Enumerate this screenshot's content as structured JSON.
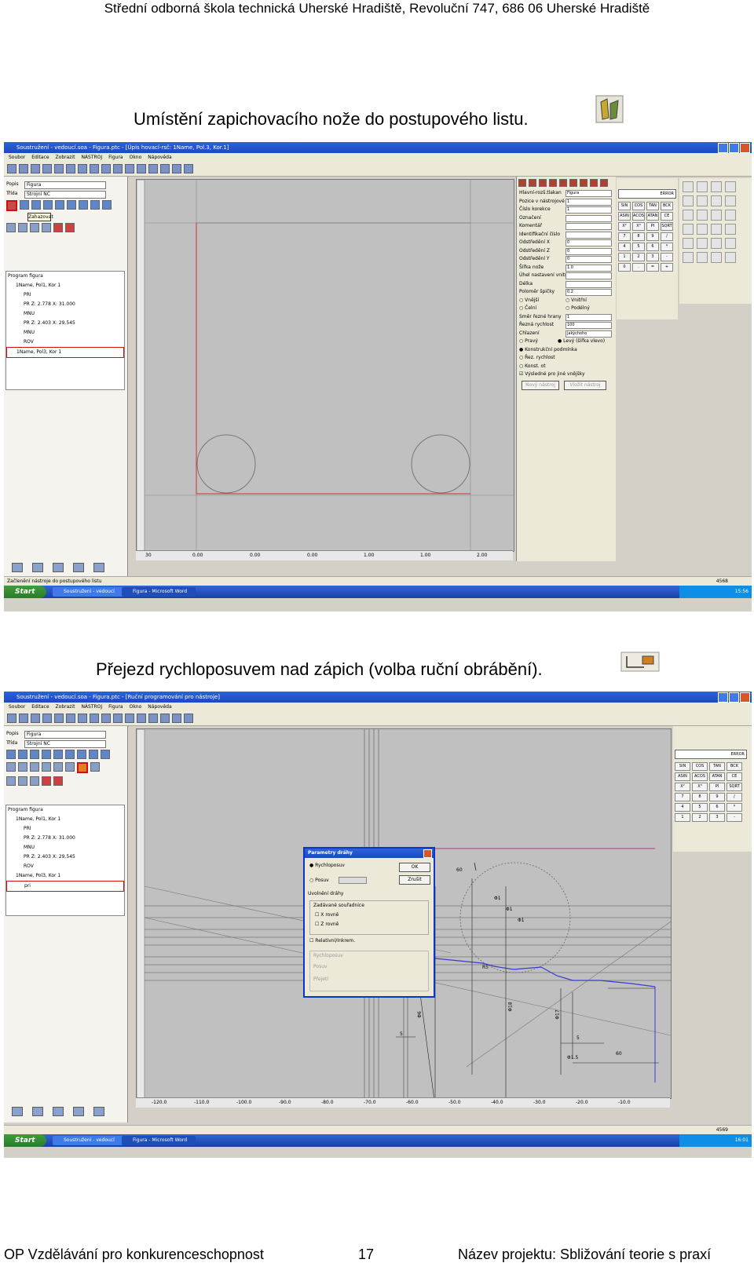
{
  "header": {
    "text": "Střední odborná škola technická Uherské Hradiště, Revoluční 747, 686 06 Uherské Hradiště"
  },
  "section1": {
    "caption": "Umístění zapichovacího nože do postupového listu.",
    "icon": "lathe-tool-icon",
    "window": {
      "title": "Soustružení - vedoucí.soa - Figura.ptc - [Úpis hovací-rsč: 1Name, Pol.3, Kor.1]",
      "menu": [
        "Soubor",
        "Editace",
        "Zobrazit",
        "NÁSTROJ",
        "Figura",
        "Okno",
        "Nápověda"
      ],
      "left": {
        "field1_label": "Popis",
        "field1_value": "Figura",
        "field2_label": "Třída",
        "field2_value": "Strojní NC",
        "tooltip": "Zahazovat"
      },
      "tree": [
        "Program figura",
        "1Name, Pol1, Kor 1",
        "PRI",
        "PR Z: 2.778 X: 31.000",
        "MNU",
        "PR Z: 2.403 X: 29.545",
        "MNU",
        "ROV",
        "1Name, Pol3, Kor 1"
      ],
      "ruler_ticks_h": [
        "30",
        "0.00",
        "0.00",
        "0.00",
        "1.00",
        "1.00",
        "2.00"
      ],
      "right_panel": [
        {
          "label": "Hlavní-rozš.tlakan",
          "value": "Figura"
        },
        {
          "label": "Pozice v nástrojové hlavě",
          "value": "1"
        },
        {
          "label": "Číslo korekce",
          "value": "1"
        },
        {
          "label": "Označení",
          "value": ""
        },
        {
          "label": "Komentář",
          "value": ""
        },
        {
          "label": "Identifikační číslo",
          "value": ""
        },
        {
          "label": "Odstředění X",
          "value": "0"
        },
        {
          "label": "Odstředění Z",
          "value": "0"
        },
        {
          "label": "Odstředění Y",
          "value": "0"
        },
        {
          "label": "Šířka nože",
          "value": "1.0"
        },
        {
          "label": "Úhel nastavení vnitřního poloměru",
          "value": ""
        },
        {
          "label": "Délka",
          "value": ""
        },
        {
          "label": "Poloměr špičky",
          "value": "0.2"
        }
      ],
      "radio_rows": [
        [
          "Vnější",
          "Vnitřní"
        ],
        [
          "Čelní",
          "Podélný"
        ]
      ],
      "right_panel_lower": [
        {
          "label": "Směr řezné hrany",
          "value": "1"
        },
        {
          "label": "Řezná rychlost",
          "value": "100"
        },
        {
          "label": "Chlazení",
          "value": "jakýchoho"
        }
      ],
      "checks": [
        "Pravý",
        "Levý (šířka vlevo)",
        "Konstrukční podmínka",
        "Řez. rychlost",
        "Konst. ot",
        "Výsledné pro jiné vnějšky"
      ],
      "buttons": [
        "Nový nástroj",
        "Vložit nástroj"
      ],
      "calc": {
        "display": "ERROR",
        "keys": [
          "SIN",
          "COS",
          "TAN",
          "BCK",
          "ASIN",
          "ACOS",
          "ATAN",
          "CE",
          "X²",
          "X³",
          "PI",
          "SQRT",
          "7",
          "8",
          "9",
          "/",
          "4",
          "5",
          "6",
          "*",
          "1",
          "2",
          "3",
          "-",
          "0",
          ".",
          "=",
          "+"
        ]
      },
      "status": "Začlenění nástroje do postupového listu",
      "status_right": "4568",
      "taskbar": {
        "start": "Start",
        "items": [
          "Soustružení - vedoucí",
          "Figura - Microsoft Word"
        ],
        "clock": "15:56"
      }
    }
  },
  "section2": {
    "caption": "Přejezd rychloposuvem nad zápich (volba ruční obrábění).",
    "icon": "manual-machining-icon",
    "window": {
      "title": "Soustružení - vedoucí.soa - Figura.ptc - [Ruční programování pro nástroje]",
      "menu": [
        "Soubor",
        "Editace",
        "Zobrazit",
        "NÁSTROJ",
        "Figura",
        "Okno",
        "Nápověda"
      ],
      "left": {
        "field1_label": "Popis",
        "field1_value": "Figura",
        "field2_label": "Třída",
        "field2_value": "Strojní NC"
      },
      "tree": [
        "Program figura",
        "1Name, Pol1, Kor 1",
        "PRI",
        "PR Z: 2.778 X: 31.000",
        "MNU",
        "PR Z: 2.403 X: 29.545",
        "ROV",
        "1Name, Pol3, Kor 1",
        "pri"
      ],
      "dialog": {
        "title": "Parametry dráhy",
        "opt1": "Rychloposuv",
        "opt2": "Posuv",
        "ok": "OK",
        "cancel": "Zrušit",
        "group": "Uvolnění dráhy",
        "subgroup": "Zadávané souřadnice",
        "checks": [
          "X rovně",
          "Z rovně"
        ],
        "check2": "Relativní/Inkrem.",
        "disabled1": "Rychloposuv",
        "disabled2": "Posuv",
        "disabled3": "Přejetí"
      },
      "dims": [
        "60",
        "Φ1",
        "Φ1",
        "R5",
        "Φ18",
        "Φ6",
        "60",
        "Φ17",
        "5",
        "Φ1.5",
        "Φ1",
        "5"
      ],
      "ruler_ticks_h": [
        "-120.0",
        "-110.0",
        "-100.0",
        "-90.0",
        "-80.0",
        "-70.0",
        "-60.0",
        "-50.0",
        "-40.0",
        "-30.0",
        "-20.0",
        "-10.0"
      ],
      "calc": {
        "display": "ERROR",
        "keys": [
          "SIN",
          "COS",
          "TAN",
          "BCK",
          "ASIN",
          "ACOS",
          "ATAN",
          "CE",
          "X²",
          "X³",
          "PI",
          "SQRT",
          "7",
          "8",
          "9",
          "/",
          "4",
          "5",
          "6",
          "*",
          "1",
          "2",
          "3",
          "-"
        ]
      },
      "status": "4569",
      "taskbar": {
        "start": "Start",
        "items": [
          "Soustružení - vedoucí",
          "Figura - Microsoft Word"
        ],
        "clock": "16:01"
      }
    }
  },
  "footer": {
    "left": "OP Vzdělávání pro konkurenceschopnost",
    "page": "17",
    "right": "Název projektu: Sbližování teorie s praxí"
  },
  "colors": {
    "drawing_bg": "#c0c0c0",
    "contour_red": "#d03030",
    "path_blue": "#3a3ad0",
    "highlight_red": "#d01010",
    "titlebar_blue": "#1c48c4"
  }
}
